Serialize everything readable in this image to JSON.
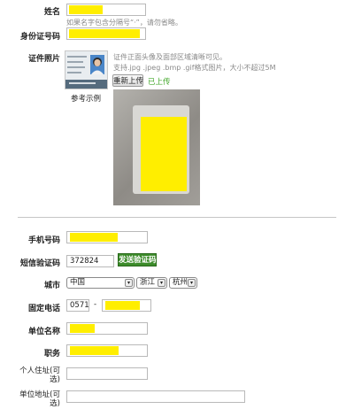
{
  "form": {
    "name_label": "姓名",
    "name_hint": "如果名字包含分隔号“·”，请勿省略。",
    "id_label": "身份证号码",
    "photo_label": "证件照片",
    "sample_label": "参考示例",
    "photo_hint_1": "证件正面头像及面部区域清晰可见。",
    "photo_hint_2": "支持.jpg .jpeg .bmp .gif格式图片，大小不超过5M",
    "reupload_button": "重新上传",
    "upload_status": "已上传",
    "phone_label": "手机号码",
    "sms_label": "短信验证码",
    "sms_value": "372824",
    "send_code_button": "发送验证码",
    "city_label": "城市",
    "country_value": "中国",
    "province_value": "浙江",
    "city_value": "杭州",
    "landline_label": "固定电话",
    "area_code": "0571",
    "dash": "-",
    "company_label": "单位名称",
    "position_label": "职务",
    "home_addr_label": "个人住址(可选)",
    "work_addr_label": "单位地址(可选)"
  },
  "colors": {
    "redaction": "#ffee00",
    "accent_green": "#3c8b2a",
    "status_green": "#44a82c"
  },
  "icons": {
    "select_arrow": "chevron-down-icon"
  }
}
